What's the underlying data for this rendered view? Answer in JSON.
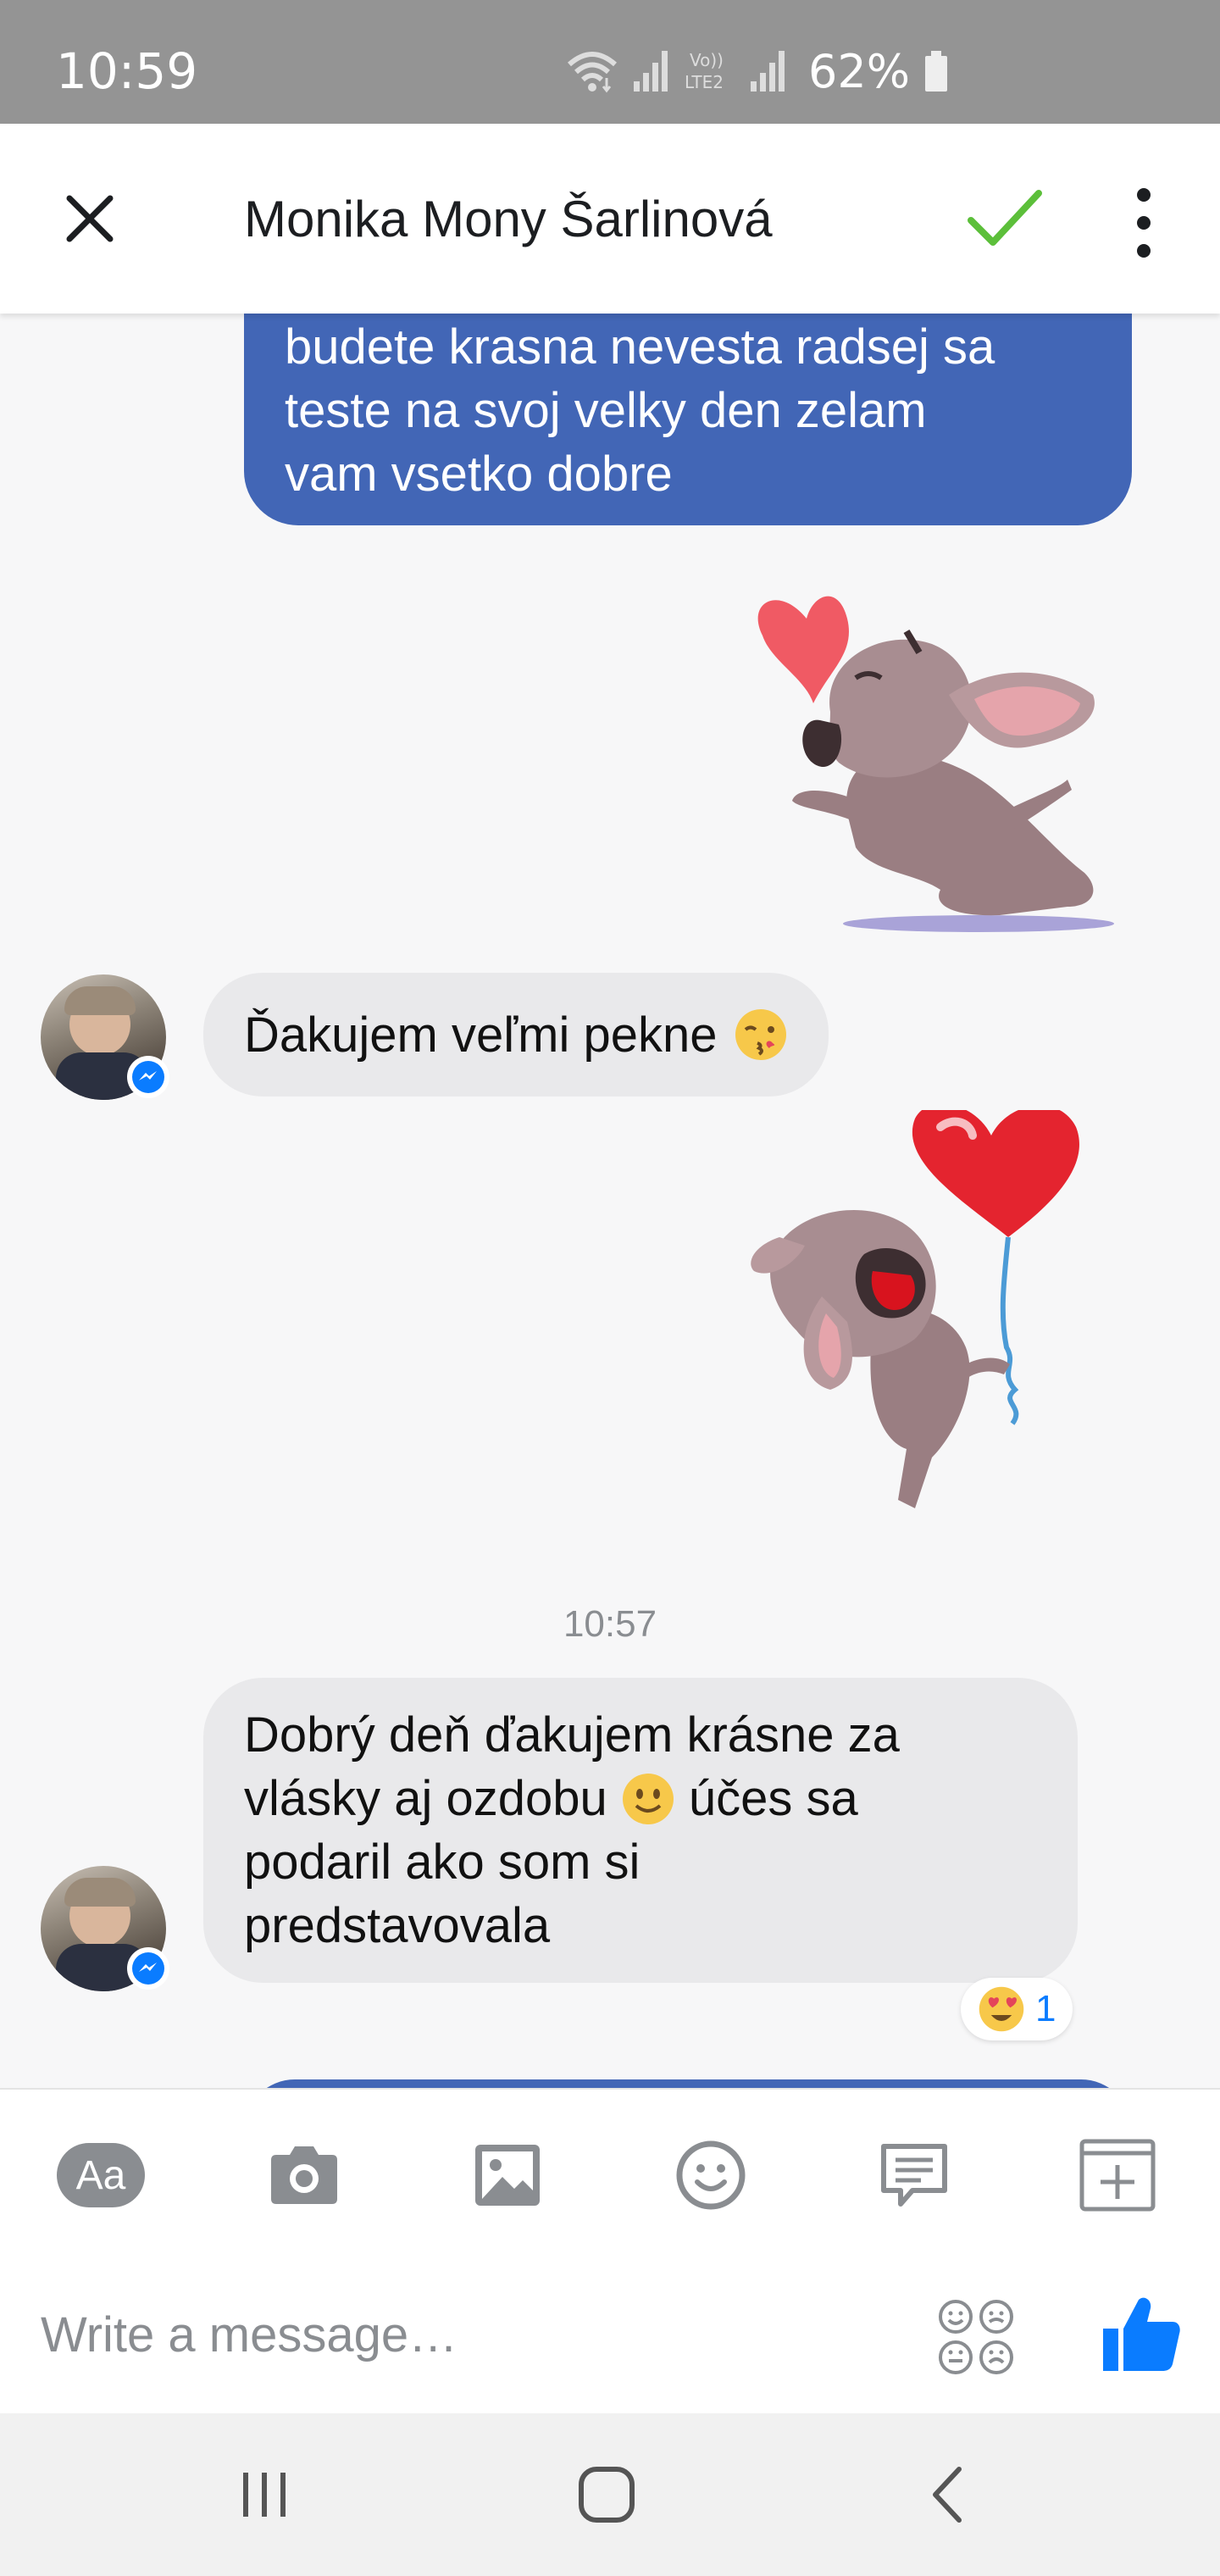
{
  "status_bar": {
    "time": "10:59",
    "battery": "62%",
    "icons": [
      "wifi-icon",
      "signal-icon",
      "volte-icon",
      "signal-icon-2",
      "battery-icon"
    ]
  },
  "header": {
    "title": "Monika Mony Šarlinová",
    "icons": [
      "close-icon",
      "check-icon",
      "more-vertical-icon"
    ]
  },
  "messages": [
    {
      "type": "outgoing-text",
      "lines": [
        "budete krasna nevesta radsej sa",
        "teste na svoj velky den zelam",
        "vam vsetko dobre"
      ]
    },
    {
      "type": "outgoing-sticker",
      "sticker": "dog-blowing-kiss-heart-sticker"
    },
    {
      "type": "incoming-text",
      "text": "Ďakujem veľmi pekne",
      "emoji": "kissing-wink-emoji"
    },
    {
      "type": "outgoing-sticker",
      "sticker": "dog-heart-balloon-sticker"
    },
    {
      "type": "timestamp",
      "text": "10:57"
    },
    {
      "type": "incoming-text",
      "lines": [
        "Dobrý deň ďakujem krásne za",
        "vlásky aj ozdobu",
        "účes sa",
        "podaril ako som si",
        "predstavovala"
      ],
      "emoji": "slightly-smiling-emoji",
      "reaction": {
        "emoji": "heart-eyes-emoji",
        "count": "1"
      }
    }
  ],
  "toolbar": {
    "items": [
      "text-format-icon",
      "camera-icon",
      "gallery-icon",
      "emoji-icon",
      "quick-reply-icon",
      "more-add-icon"
    ],
    "aa_label": "Aa"
  },
  "composer": {
    "placeholder": "Write a message…",
    "icons": [
      "emoji-set-icon",
      "like-icon"
    ]
  },
  "colors": {
    "outgoing_bubble": "#4266b6",
    "incoming_bubble": "#e9e9eb",
    "accent": "#0a7cff",
    "check_green": "#5cbf3a"
  }
}
